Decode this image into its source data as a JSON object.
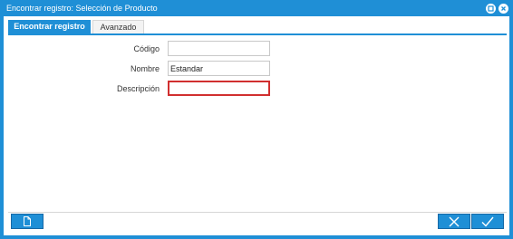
{
  "window": {
    "title": "Encontrar registro: Selección de Producto",
    "maximize_icon": "window-maximize-icon",
    "close_icon": "window-close-icon"
  },
  "tabs": [
    {
      "label": "Encontrar registro",
      "active": true
    },
    {
      "label": "Avanzado",
      "active": false
    }
  ],
  "form": {
    "codigo_label": "Código",
    "codigo_value": "",
    "nombre_label": "Nombre",
    "nombre_value": "Estandar",
    "descripcion_label": "Descripción",
    "descripcion_value": ""
  },
  "footer": {
    "new_record_icon": "new-record-icon",
    "cancel_icon": "cancel-x-icon",
    "ok_icon": "ok-check-icon"
  },
  "colors": {
    "accent": "#1f8fd6",
    "focus_border": "#d12f2f"
  }
}
